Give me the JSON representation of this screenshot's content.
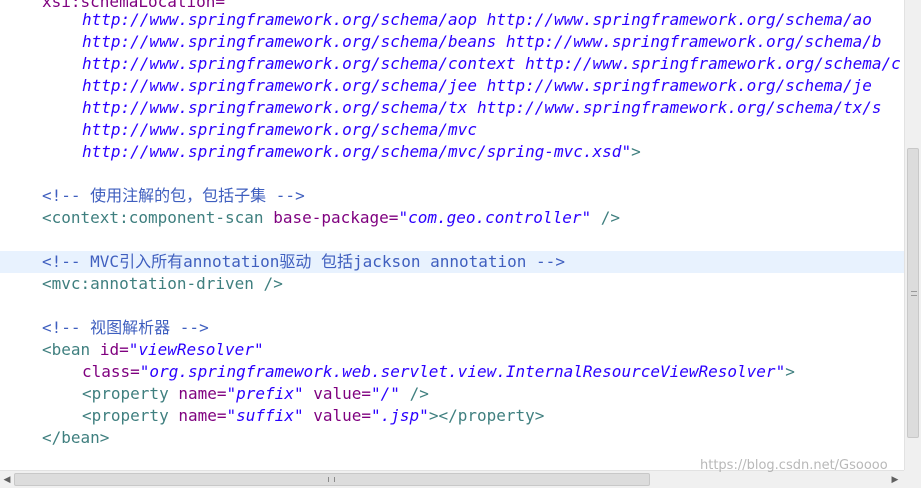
{
  "editor": {
    "schema_header": "xsi:schemaLocation=",
    "schema_lines": [
      [
        "http://www.springframework.org/schema/aop",
        "http://www.springframework.org/schema/ao"
      ],
      [
        "http://www.springframework.org/schema/beans",
        "http://www.springframework.org/schema/b"
      ],
      [
        "http://www.springframework.org/schema/context",
        "http://www.springframework.org/schema/c"
      ],
      [
        "http://www.springframework.org/schema/jee",
        "http://www.springframework.org/schema/je"
      ],
      [
        "http://www.springframework.org/schema/tx",
        "http://www.springframework.org/schema/tx/s"
      ],
      [
        "http://www.springframework.org/schema/mvc",
        ""
      ],
      [
        "http://www.springframework.org/schema/mvc/spring-mvc.xsd\"",
        ""
      ]
    ],
    "schema_close": ">",
    "comment1": "<!-- 使用注解的包，包括子集 -->",
    "component_scan_tag": "<context:component-scan",
    "base_package_attr": "base-package=",
    "base_package_value": "\"com.geo.controller\"",
    "component_scan_close": "/>",
    "comment2": "<!-- MVC引入所有annotation驱动 包括jackson annotation -->",
    "annotation_driven": "<mvc:annotation-driven />",
    "comment3": "<!-- 视图解析器 -->",
    "bean_open": "<bean",
    "id_attr": "id=",
    "id_value": "\"viewResolver\"",
    "class_attr": "class=",
    "class_value": "\"org.springframework.web.servlet.view.InternalResourceViewResolver\"",
    "class_close": ">",
    "property_open": "<property",
    "name_attr": "name=",
    "value_attr": "value=",
    "prefix_name": "\"prefix\"",
    "prefix_value": "\"/\"",
    "prefix_close": "/>",
    "suffix_name": "\"suffix\"",
    "suffix_value": "\".jsp\"",
    "suffix_close": "></property>",
    "bean_close": "</bean>"
  },
  "watermark": "https://blog.csdn.net/Gsoooo",
  "scrollbars": {
    "left_arrow": "◀",
    "right_arrow": "▶"
  },
  "colors": {
    "tag": "#3f7f7f",
    "attribute": "#7f007f",
    "value": "#2a00ff",
    "comment": "#3f5fbf",
    "current_line": "#e8f2fe"
  }
}
